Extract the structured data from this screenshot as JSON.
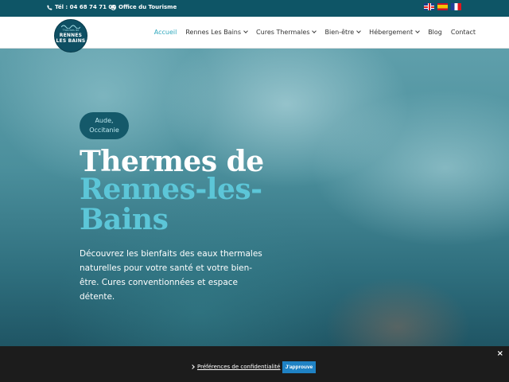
{
  "topbar": {
    "phone": "Tél : 04 68 74 71 00",
    "office": "Office du Tourisme",
    "languages": [
      "English",
      "Español",
      "Français"
    ]
  },
  "logo": {
    "line1": "Thermes de",
    "line2": "RENNES",
    "line3": "LES BAINS"
  },
  "nav": {
    "items": [
      {
        "label": "Accueil",
        "active": true,
        "dropdown": false
      },
      {
        "label": "Rennes Les Bains",
        "active": false,
        "dropdown": true
      },
      {
        "label": "Cures Thermales",
        "active": false,
        "dropdown": true
      },
      {
        "label": "Bien-être",
        "active": false,
        "dropdown": true
      },
      {
        "label": "Hébergement",
        "active": false,
        "dropdown": true
      },
      {
        "label": "Blog",
        "active": false,
        "dropdown": false
      },
      {
        "label": "Contact",
        "active": false,
        "dropdown": false
      }
    ],
    "accent_color": "#2fa8bd"
  },
  "hero": {
    "badge_line1": "Aude,",
    "badge_line2": "Occitanie",
    "title_line1": "Thermes de",
    "title_line2": "Rennes-les-Bains",
    "description": "Découvrez les bienfaits des eaux thermales naturelles pour votre santé et votre bien-être. Cures conventionnées et espace détente.",
    "title_accent_color": "#5cc6d8"
  },
  "cookie": {
    "close": "×",
    "preferences": "Préférences de confidentialité",
    "accept": "J'approuve"
  }
}
